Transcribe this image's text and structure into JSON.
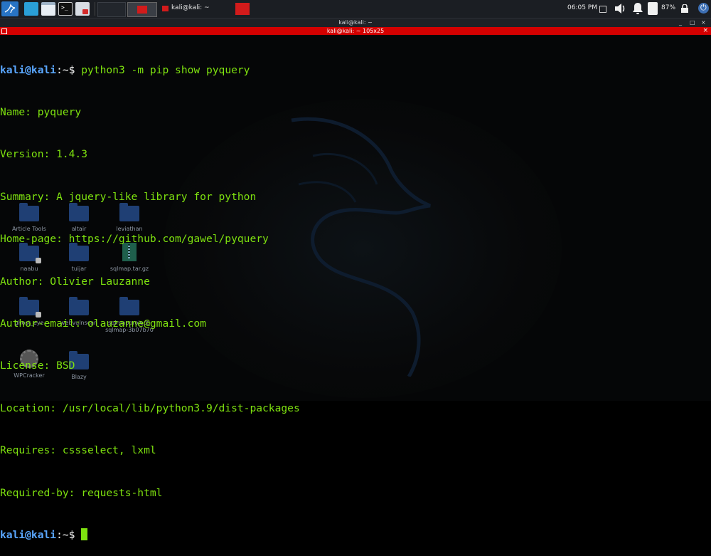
{
  "panel": {
    "clock": "06:05 PM",
    "battery": "87%",
    "task_label": "kali@kali: ~"
  },
  "window": {
    "title": "kali@kali: ~",
    "tab_title": "kali@kali: ~ 105x25",
    "min": "_",
    "max": "□",
    "close": "×"
  },
  "desktop_icons": [
    {
      "label": "Article Tools"
    },
    {
      "label": "altair"
    },
    {
      "label": "leviathan"
    },
    {
      "label": "naabu"
    },
    {
      "label": "tuijar"
    },
    {
      "label": "sqlmap.tar.gz"
    },
    {
      "label": "ghost_eye"
    },
    {
      "label": "webvulnscan"
    },
    {
      "label": "sqlmapproject-\nsqlmap-3b07b70"
    },
    {
      "label": "WPCracker"
    },
    {
      "label": "Blazy"
    }
  ],
  "terminal": {
    "prompt_user": "kali@kali",
    "prompt_path": ":~$ ",
    "command": "python3 -m pip show pyquery",
    "output": [
      "Name: pyquery",
      "Version: 1.4.3",
      "Summary: A jquery-like library for python",
      "Home-page: https://github.com/gawel/pyquery",
      "Author: Olivier Lauzanne",
      "Author-email: olauzanne@gmail.com",
      "License: BSD",
      "Location: /usr/local/lib/python3.9/dist-packages",
      "Requires: cssselect, lxml",
      "Required-by: requests-html"
    ],
    "prompt_user_2": "kali@kali",
    "prompt_path_2": ":~$ "
  },
  "colors": {
    "terminal_text": "#7ee10f",
    "prompt_user": "#5aa7ff",
    "tab_bar": "#d40000",
    "panel_bg": "#1b1e23"
  }
}
